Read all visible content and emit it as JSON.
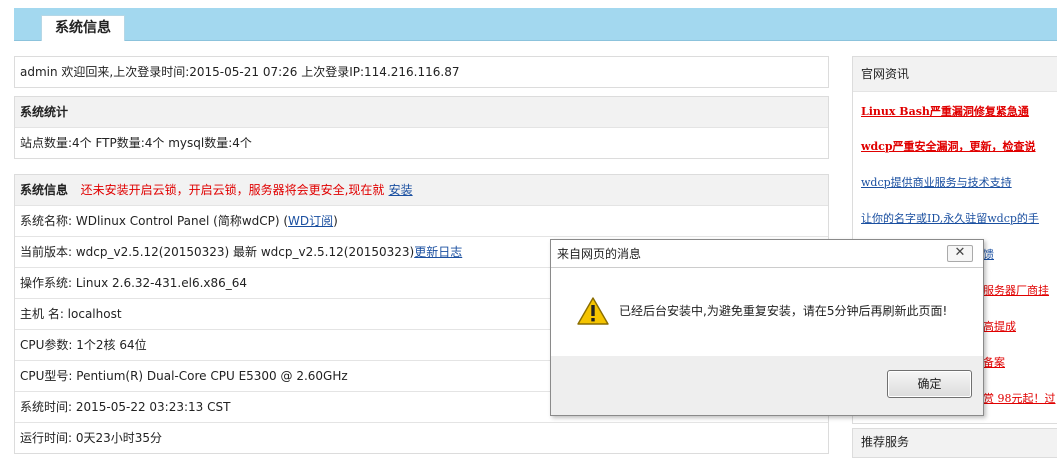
{
  "header": {
    "tab_label": "系统信息"
  },
  "welcome": {
    "text": "admin 欢迎回来,上次登录时间:2015-05-21 07:26 上次登录IP:114.216.116.87"
  },
  "stats": {
    "title": "系统统计",
    "values": "站点数量:4个  FTP数量:4个  mysql数量:4个"
  },
  "sysinfo": {
    "title": "系统信息",
    "notice": "还未安装开启云锁，开启云锁，服务器将会更安全,现在就",
    "install_link": "安装",
    "name_label": "系统名称: WDlinux Control Panel (简称wdCP) (",
    "name_link": "WD订阅",
    "name_tail": ")",
    "version_text": "当前版本: wdcp_v2.5.12(20150323) 最新 wdcp_v2.5.12(20150323)",
    "changelog_link": "更新日志",
    "os": "操作系统: Linux 2.6.32-431.el6.x86_64",
    "hostname": "主机 名: localhost",
    "cpu_params": "CPU参数: 1个2核 64位",
    "cpu_model": "CPU型号:  Pentium(R) Dual-Core CPU E5300 @ 2.60GHz",
    "sys_time": "系统时间: 2015-05-22 03:23:13 CST",
    "uptime": "运行时间: 0天23小时35分"
  },
  "sidebar": {
    "news_title": "官网资讯",
    "news": [
      "Linux Bash严重漏洞修复紧急通",
      "wdcp严重安全漏洞，更新，检查说",
      "wdcp提供商业服务与技术支持",
      "让你的名字或ID,永久驻留wdcp的手"
    ],
    "partial": [
      "馈",
      "服务器厂商挂",
      "高提成",
      "备案",
      "赏 98元起！过"
    ],
    "recommend_title": "推荐服务"
  },
  "dialog": {
    "title": "来自网页的消息",
    "close_glyph": "✕",
    "message": "已经后台安装中,为避免重复安装，请在5分钟后再刷新此页面!",
    "ok_label": "确定",
    "icon": "warning-icon"
  },
  "colors": {
    "header_bg": "#a3d8ef",
    "alert_red": "#e00000",
    "link_blue": "#1a4fa0"
  }
}
